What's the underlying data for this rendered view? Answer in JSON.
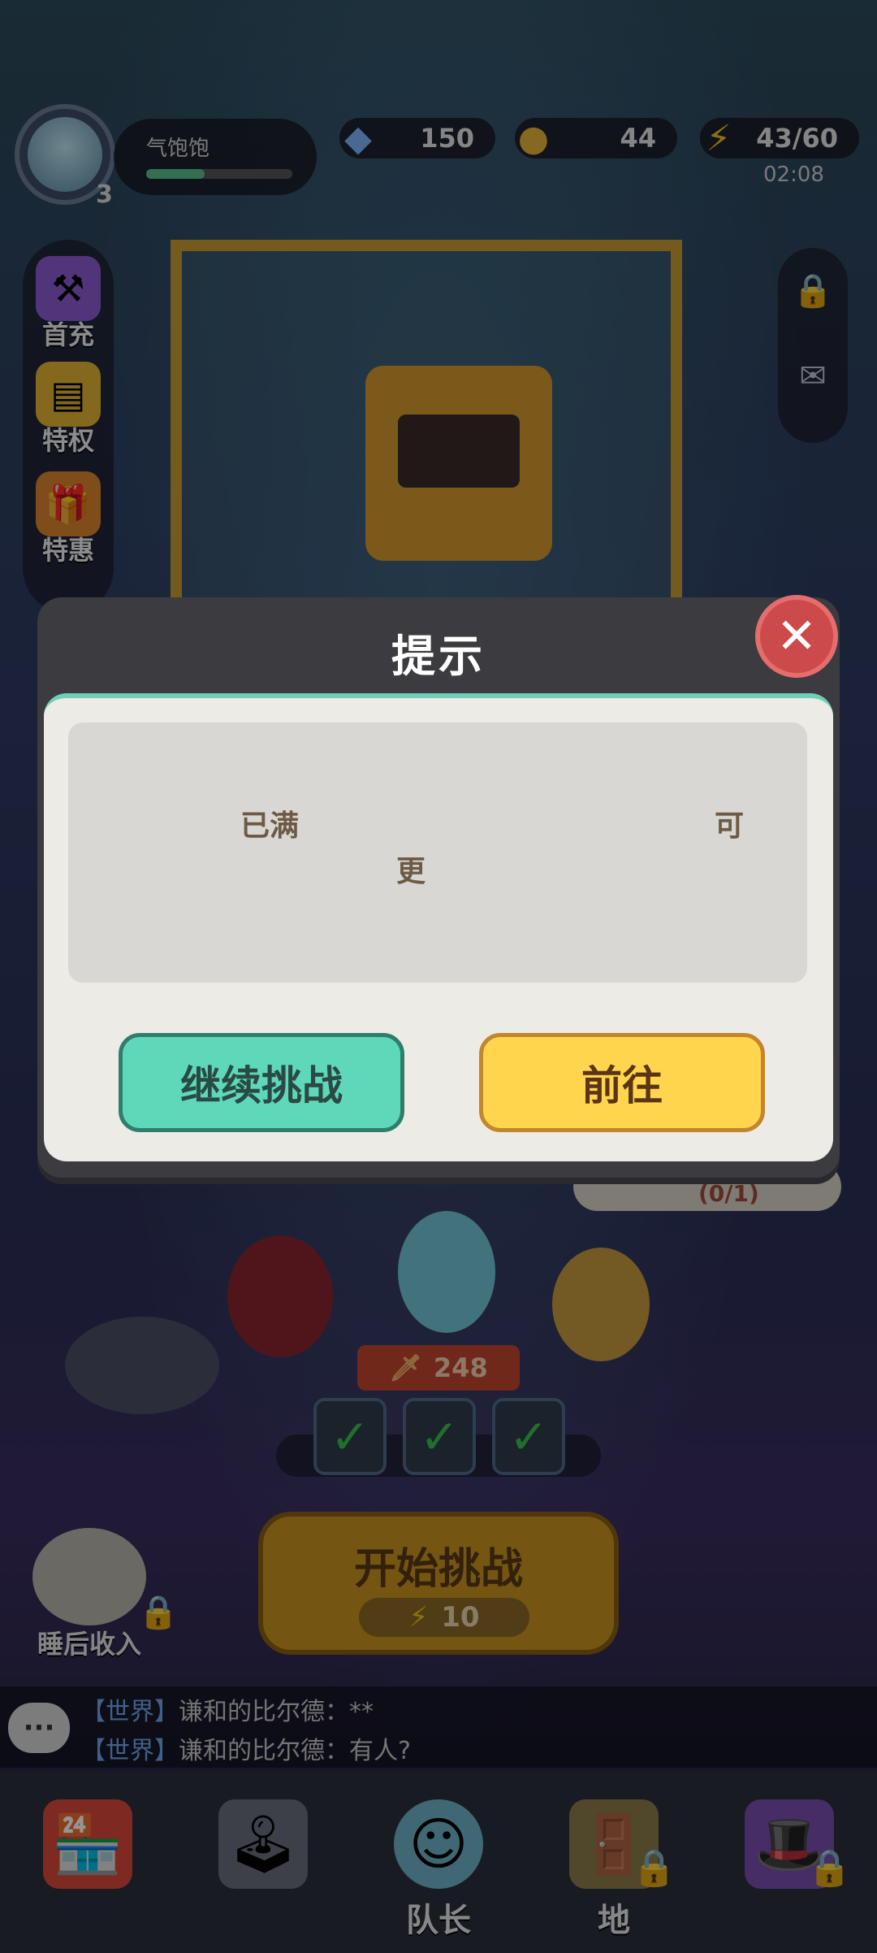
{
  "player": {
    "name": "气饱饱",
    "level": "3",
    "hunger_fraction": 0.4
  },
  "resources": {
    "gems": "150",
    "coins": "44",
    "energy": "43/60",
    "energy_timer": "02:08"
  },
  "left_menu": [
    {
      "label": "首充",
      "icon": "hammer-icon"
    },
    {
      "label": "特权",
      "icon": "privilege-card-icon"
    },
    {
      "label": "特惠",
      "icon": "gift-box-icon"
    }
  ],
  "right_menu": [
    {
      "icon": "lock-icon"
    },
    {
      "icon": "mail-icon"
    }
  ],
  "dialog": {
    "title": "提示",
    "message_part1": "已满",
    "message_part2": "可",
    "message_part3": "更",
    "continue_label": "继续挑战",
    "go_label": "前往"
  },
  "quest": {
    "count": "(0/1)"
  },
  "team": {
    "power": "248"
  },
  "start": {
    "label": "开始挑战",
    "cost": "10"
  },
  "sleep": {
    "label": "睡后收入"
  },
  "chat": {
    "lines": [
      {
        "channel": "【世界】",
        "text": "谦和的比尔德：**"
      },
      {
        "channel": "【世界】",
        "text": "谦和的比尔德：有人?"
      }
    ]
  },
  "nav": [
    {
      "label": "",
      "icon": "shop-icon",
      "locked": false
    },
    {
      "label": "",
      "icon": "arcade-machine-icon",
      "locked": false
    },
    {
      "label": "队长",
      "icon": "captain-icon",
      "locked": false
    },
    {
      "label": "地",
      "icon": "map-icon",
      "locked": true
    },
    {
      "label": "",
      "icon": "hat-icon",
      "locked": true
    }
  ],
  "colors": {
    "accent_green": "#5fd8b9",
    "accent_yellow": "#ffd54e",
    "close_red": "#cc4a4a"
  }
}
